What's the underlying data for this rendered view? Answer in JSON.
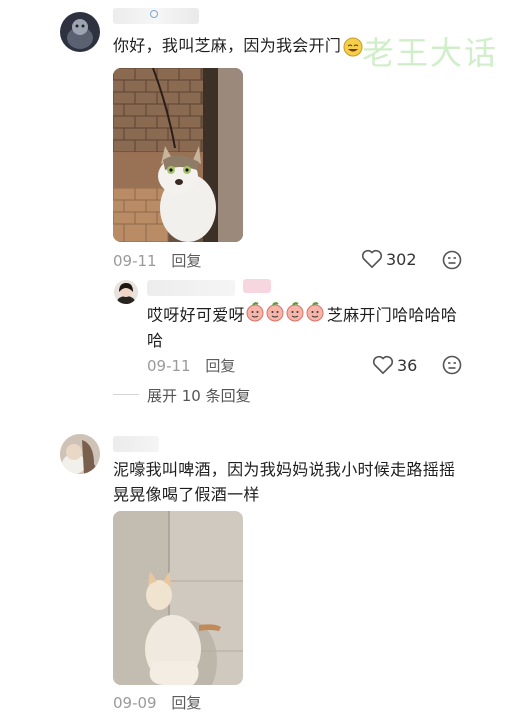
{
  "watermark": "老王大话",
  "comments": [
    {
      "text": "你好，我叫芝麻，因为我会开门",
      "date": "09-11",
      "reply_label": "回复",
      "likes": "302",
      "reply": {
        "text_line1": "哎呀好可爱呀",
        "text_line1_tail": "芝麻开门哈哈哈哈",
        "text_line2": "哈",
        "date": "09-11",
        "reply_label": "回复",
        "likes": "36"
      },
      "expand_label": "展开 10 条回复"
    },
    {
      "text_line1": "泥嚎我叫啤酒，因为我妈妈说我小时候走路摇摇",
      "text_line2": "晃晃像喝了假酒一样",
      "date": "09-09",
      "reply_label": "回复"
    }
  ],
  "colors": {
    "like_icon": "#555555",
    "watermark": "#c8ecc0"
  },
  "icons": [
    "heart-icon",
    "dislike-face-icon",
    "peach-emoji-icon",
    "laugh-emoji-icon"
  ]
}
